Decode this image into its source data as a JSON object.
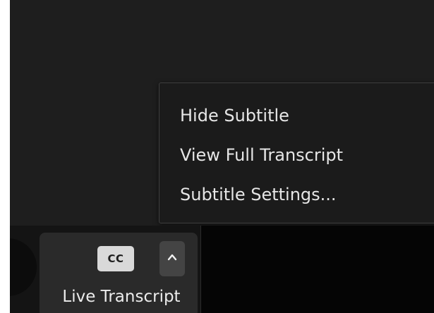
{
  "subtitle_menu": {
    "items": [
      {
        "label": "Hide Subtitle"
      },
      {
        "label": "View Full Transcript"
      },
      {
        "label": "Subtitle Settings..."
      }
    ]
  },
  "toolbar": {
    "live_transcript": {
      "cc_badge": "CC",
      "label": "Live Transcript",
      "chevron_icon": "chevron-up-icon"
    }
  },
  "colors": {
    "background": "#1f1f1f",
    "menu_background": "#1b1b1b",
    "menu_border": "#3f3f3f",
    "button_group": "#2a2a2a",
    "cc_badge": "#d9d9d9",
    "chevron_button": "#444444",
    "text": "#e6e6e6"
  }
}
